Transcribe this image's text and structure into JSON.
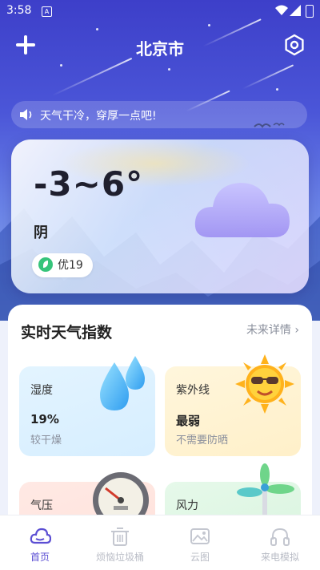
{
  "status_bar": {
    "time": "3:58",
    "sim_badge": "A"
  },
  "header": {
    "city": "北京市"
  },
  "notice": {
    "text": "天气干冷，穿厚一点吧!"
  },
  "weather": {
    "temperature": "-3~6°",
    "condition": "阴",
    "aqi_label": "优19"
  },
  "index_panel": {
    "title": "实时天气指数",
    "more": "未来详情",
    "tiles": [
      {
        "label": "湿度",
        "value": "19%",
        "desc": "较干燥"
      },
      {
        "label": "紫外线",
        "value": "最弱",
        "desc": "不需要防晒"
      },
      {
        "label": "气压"
      },
      {
        "label": "风力"
      }
    ]
  },
  "nav": [
    {
      "label": "首页",
      "icon": "cloud-icon",
      "active": true
    },
    {
      "label": "烦恼垃圾桶",
      "icon": "trash-icon",
      "active": false
    },
    {
      "label": "云图",
      "icon": "image-icon",
      "active": false
    },
    {
      "label": "来电模拟",
      "icon": "headphones-icon",
      "active": false
    }
  ],
  "colors": {
    "accent": "#5b4ed3",
    "sky_top": "#3d3fc9",
    "aqi_leaf": "#36c47a"
  }
}
